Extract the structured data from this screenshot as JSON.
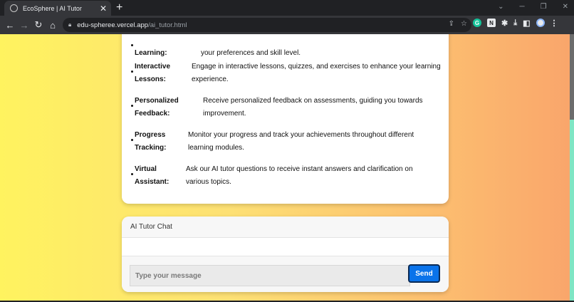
{
  "browser": {
    "tab_title": "EcoSphere | AI Tutor",
    "tab_close": "✕",
    "new_tab": "+",
    "url_host": "edu-spheree.vercel.app",
    "url_path": "/ai_tutor.html"
  },
  "features": [
    {
      "name_line1": "",
      "name_line2": "Learning:",
      "desc_line1": "",
      "desc_line2": "your preferences and skill level."
    },
    {
      "name_line1": "Interactive",
      "name_line2": "Lessons:",
      "desc_line1": "Engage in interactive lessons, quizzes, and exercises to enhance your learning",
      "desc_line2": "experience."
    },
    {
      "name_line1": "Personalized",
      "name_line2": "Feedback:",
      "desc_line1": "Receive personalized feedback on assessments, guiding you towards",
      "desc_line2": "improvement."
    },
    {
      "name_line1": "Progress",
      "name_line2": "Tracking:",
      "desc_line1": "Monitor your progress and track your achievements throughout different",
      "desc_line2": "learning modules."
    },
    {
      "name_line1": "Virtual",
      "name_line2": "Assistant:",
      "desc_line1": "Ask our AI tutor questions to receive instant answers and clarification on",
      "desc_line2": "various topics."
    }
  ],
  "chat": {
    "title": "AI Tutor Chat",
    "input_placeholder": "Type your message",
    "send_label": "Send"
  }
}
